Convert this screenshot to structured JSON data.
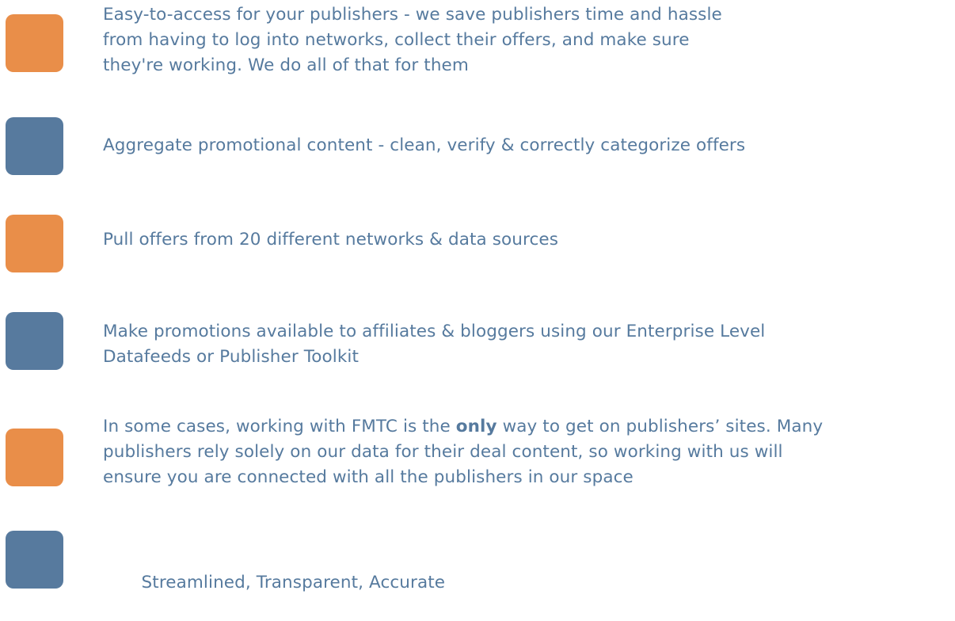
{
  "benefits": {
    "items": [
      {
        "color": "orange",
        "lines": [
          "Easy-to-access for your publishers - we save publishers time and hassle",
          "from having to log into networks, collect their offers, and make sure",
          "they're working. We do all of that for them"
        ]
      },
      {
        "color": "blue",
        "lines": [
          "Aggregate promotional content - clean, verify & correctly categorize offers"
        ]
      },
      {
        "color": "orange",
        "lines": [
          "Pull offers from 20 different networks & data sources"
        ]
      },
      {
        "color": "blue",
        "lines": [
          "Make promotions available to affiliates & bloggers using our Enterprise Level",
          "Datafeeds or Publisher Toolkit"
        ]
      },
      {
        "color": "orange",
        "line1_before": "In some cases, working with FMTC is the ",
        "line1_bold": "only",
        "line1_after": " way to get on publishers’ sites. Many",
        "lines": [
          "publishers rely solely on our data for their deal content, so working with us will",
          "ensure you are connected with all the publishers in our space"
        ]
      },
      {
        "color": "blue",
        "lines": [
          " Streamlined, Transparent, Accurate"
        ]
      }
    ]
  },
  "colors": {
    "orange": "#e98e49",
    "blue": "#577a9e",
    "text": "#567a9e"
  }
}
